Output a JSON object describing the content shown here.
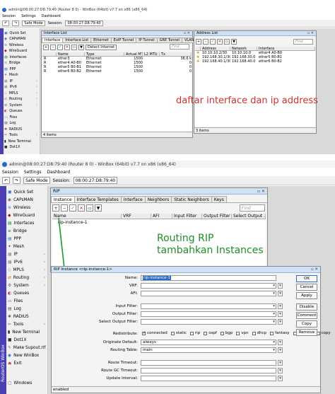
{
  "shot1": {
    "window_title": "admin@08:00:27:D8:79:40 (Router 8 0) - WinBox (64bit) v7.7 on x86 (x86_64)",
    "menu": [
      "Session",
      "Settings",
      "Dashboard"
    ],
    "toolbar": {
      "safe_mode": "Safe Mode",
      "session_label": "Session:",
      "session_value": "08:00:27:D8:79:40"
    },
    "sidebar": [
      "Quick Set",
      "CAPsMAN",
      "Wireless",
      "WireGuard",
      "Interfaces",
      "Bridge",
      "PPP",
      "Mesh",
      "IP",
      "IPv6",
      "MPLS",
      "Routing",
      "System",
      "Queues",
      "Files",
      "Log",
      "RADIUS",
      "Tools",
      "New Terminal",
      "Dot1X"
    ],
    "interface_list": {
      "title": "Interface List",
      "tabs": [
        "Interface",
        "Interface List",
        "Ethernet",
        "EoIP Tunnel",
        "IP Tunnel",
        "GRE Tunnel",
        "VLAN"
      ],
      "detect_label": "Detect Internet",
      "find_placeholder": "Find",
      "columns": [
        "Name",
        "Type",
        "Actual MTU",
        "L2 MTU",
        "Tx"
      ],
      "rows": [
        {
          "flag": "R",
          "name": "ether3",
          "type": "Ethernet",
          "mtu": "1500",
          "tx": "38.6 k"
        },
        {
          "flag": "R",
          "name": "ether4 A0-B0",
          "type": "Ethernet",
          "mtu": "1500",
          "tx": "0"
        },
        {
          "flag": "R",
          "name": "ether5 B0-B1",
          "type": "Ethernet",
          "mtu": "1500",
          "tx": "0"
        },
        {
          "flag": "R",
          "name": "ether6 B0-B2",
          "type": "Ethernet",
          "mtu": "1500",
          "tx": "0"
        }
      ],
      "status": "4 items"
    },
    "address_list": {
      "title": "Address List",
      "find_placeholder": "Find",
      "columns": [
        "Address",
        "Network",
        "Interface"
      ],
      "rows": [
        {
          "address": "10.10.10.2/30",
          "network": "10.10.10.0",
          "interface": "ether4 A0-B0"
        },
        {
          "address": "192.168.30.1/30",
          "network": "192.168.30.0",
          "interface": "ether5 B0-B1"
        },
        {
          "address": "192.168.40.1/30",
          "network": "192.168.40.0",
          "interface": "ether6 B0-B2"
        }
      ],
      "status": "3 items"
    },
    "annotation": "daftar interface dan ip address"
  },
  "shot2": {
    "window_title": "admin@08:00:27:D8:79:40 (Router 8 0) - WinBox (64bit) v7.7 on x86 (x86_64)",
    "menu": [
      "Session",
      "Settings",
      "Dashboard"
    ],
    "toolbar": {
      "safe_mode": "Safe Mode",
      "session_label": "Session:",
      "session_value": "08:00:27:D8:79:40"
    },
    "sidebar": [
      "Quick Set",
      "CAPsMAN",
      "Wireless",
      "WireGuard",
      "Interfaces",
      "Bridge",
      "PPP",
      "Mesh",
      "IP",
      "IPv6",
      "MPLS",
      "Routing",
      "System",
      "Queues",
      "Files",
      "Log",
      "RADIUS",
      "Tools",
      "New Terminal",
      "Dot1X",
      "Make Supout.rif",
      "New WinBox",
      "Exit",
      "Windows"
    ],
    "brand": "RouterOS WinBox",
    "rip": {
      "title": "RIP",
      "tabs": [
        "Instance",
        "Interface Templates",
        "Interface",
        "Neighbors",
        "Static Neighbors",
        "Keys"
      ],
      "find_placeholder": "Find",
      "columns": [
        "Name",
        "VRF",
        "AFI",
        "Input Filter",
        "Output Filter",
        "Select Output ..."
      ],
      "rows": [
        {
          "name": "rip-instance-1"
        }
      ]
    },
    "annotation_line1": "Routing RIP",
    "annotation_line2": "tambahkan Instances",
    "dialog": {
      "title": "RIP Instance <rip-instance-1>",
      "buttons": [
        "OK",
        "Cancel",
        "Apply",
        "Disable",
        "Comment",
        "Copy",
        "Remove"
      ],
      "labels": {
        "name": "Name:",
        "vrf": "VRF:",
        "afi": "AFI:",
        "input_filter": "Input Filter:",
        "output_filter": "Output Filter:",
        "select_output": "Select Output Filter:",
        "redistribute": "Redistribute:",
        "originate": "Originate Default:",
        "routing_table": "Routing Table:",
        "route_timeout": "Route Timeout:",
        "route_gc": "Route GC Timeout:",
        "update_interval": "Update Interval:"
      },
      "values": {
        "name": "rip-instance-1",
        "originate": "always",
        "routing_table": "main"
      },
      "redistribute": [
        {
          "label": "connected",
          "checked": true
        },
        {
          "label": "static",
          "checked": false
        },
        {
          "label": "rip",
          "checked": false
        },
        {
          "label": "ospf",
          "checked": false
        },
        {
          "label": "bgp",
          "checked": false
        },
        {
          "label": "vpn",
          "checked": false
        },
        {
          "label": "dhcp",
          "checked": false
        },
        {
          "label": "fantasy",
          "checked": false
        },
        {
          "label": "modem",
          "checked": false
        },
        {
          "label": "copy",
          "checked": false
        }
      ],
      "status": "enabled"
    }
  }
}
